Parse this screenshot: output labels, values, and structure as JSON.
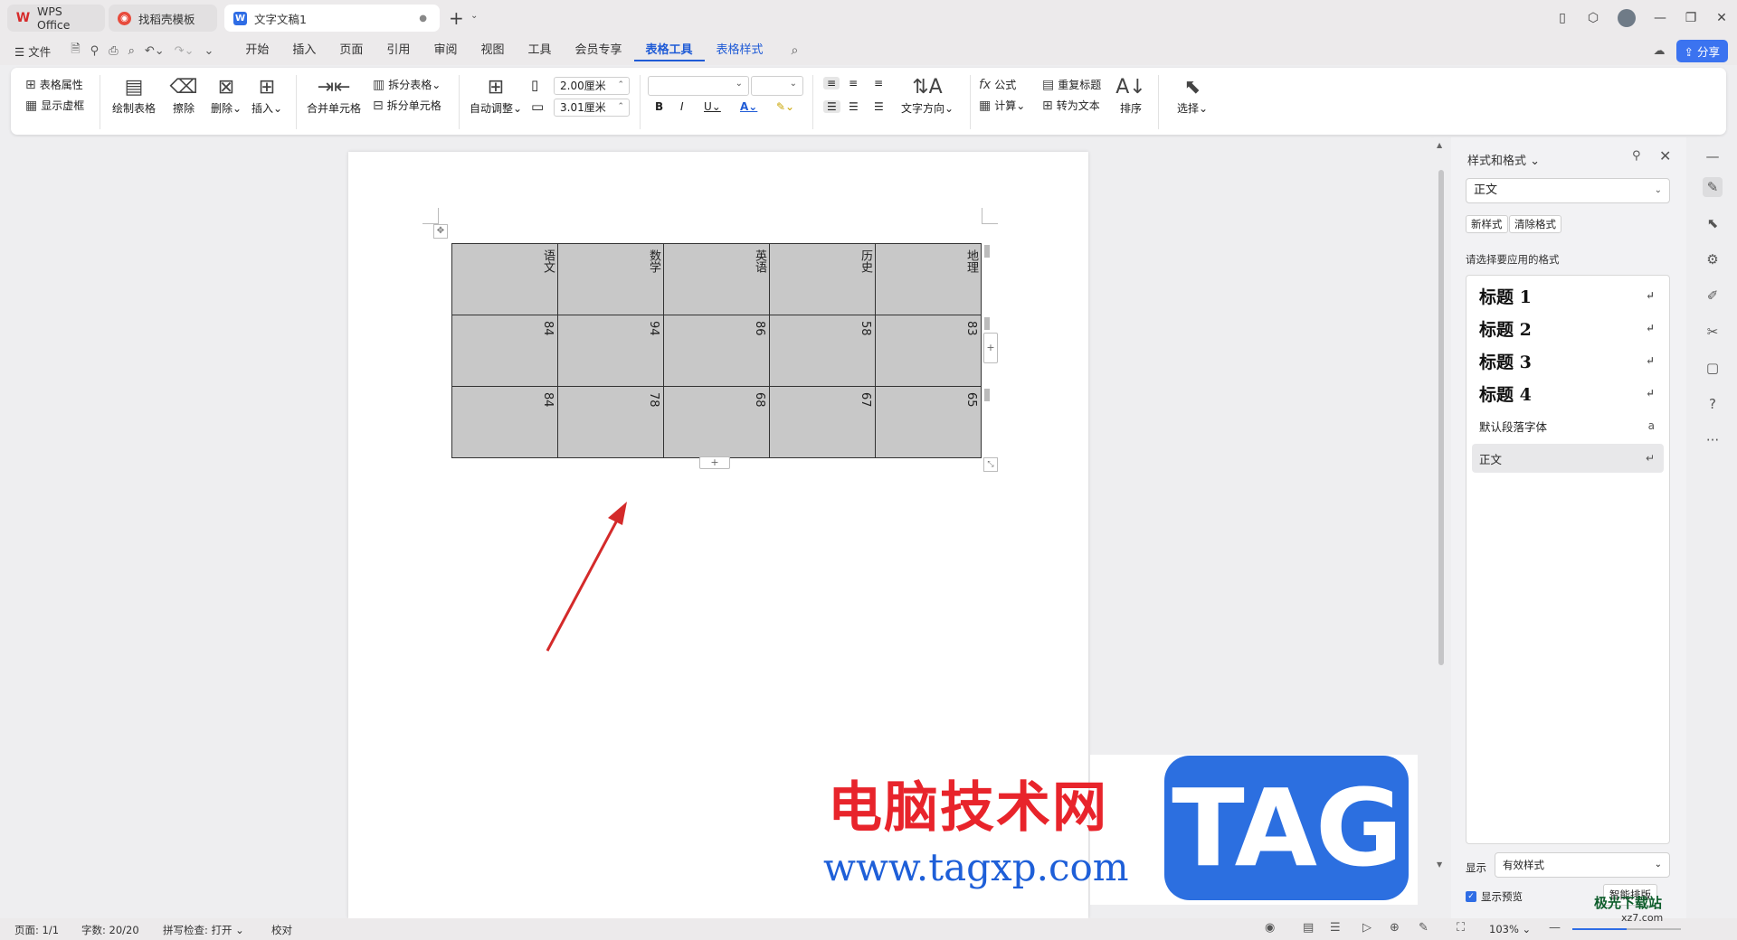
{
  "tabs": {
    "wps": "WPS Office",
    "template": "找稻壳模板",
    "document": "文字文稿1"
  },
  "menu": {
    "file": "文件",
    "items": [
      "开始",
      "插入",
      "页面",
      "引用",
      "审阅",
      "视图",
      "工具",
      "会员专享",
      "表格工具",
      "表格样式"
    ],
    "active": "表格工具",
    "share": "分享"
  },
  "ribbon": {
    "table_props": "表格属性",
    "show_gridlines": "显示虚框",
    "draw_table": "绘制表格",
    "erase": "擦除",
    "delete": "删除",
    "insert": "插入",
    "merge_cells": "合并单元格",
    "split_table": "拆分表格",
    "split_cells": "拆分单元格",
    "auto_fit": "自动调整",
    "width_value": "2.00厘米",
    "height_value": "3.01厘米",
    "text_direction": "文字方向",
    "formula": "公式",
    "calculate": "计算",
    "repeat_header": "重复标题",
    "convert_text": "转为文本",
    "sort": "排序",
    "select": "选择"
  },
  "table": {
    "headers": [
      "语文",
      "数学",
      "英语",
      "历史",
      "地理"
    ],
    "rows": [
      [
        "84",
        "94",
        "86",
        "58",
        "83"
      ],
      [
        "84",
        "78",
        "68",
        "67",
        "65"
      ]
    ]
  },
  "panel": {
    "title": "样式和格式",
    "current_style": "正文",
    "new_style": "新样式",
    "clear_format": "清除格式",
    "hint": "请选择要应用的格式",
    "styles": [
      {
        "label": "标题  1",
        "symbol": "↵"
      },
      {
        "label": "标题  2",
        "symbol": "↵"
      },
      {
        "label": "标题  3",
        "symbol": "↵"
      },
      {
        "label": "标题 4",
        "symbol": "↵"
      },
      {
        "label": "默认段落字体",
        "symbol": "a"
      },
      {
        "label": "正文",
        "symbol": "↵"
      }
    ],
    "show_label": "显示",
    "show_value": "有效样式",
    "show_preview": "显示预览",
    "smart_layout": "智能排版"
  },
  "status": {
    "page": "页面: 1/1",
    "words": "字数: 20/20",
    "spellcheck": "拼写检查: 打开",
    "proofread": "校对",
    "zoom": "103%",
    "zoom_fraction": 0.5
  },
  "watermark": {
    "cn": "电脑技术网",
    "url": "www.tagxp.com",
    "tag": "TAG",
    "site": "极光下载站",
    "site_url": "xz7.com"
  },
  "colors": {
    "accent": "#1f5bd6",
    "table_fill": "#c8c8c8",
    "arrow": "#d42a2a",
    "watermark_red": "#e8242b",
    "watermark_blue": "#2c6fe0"
  }
}
